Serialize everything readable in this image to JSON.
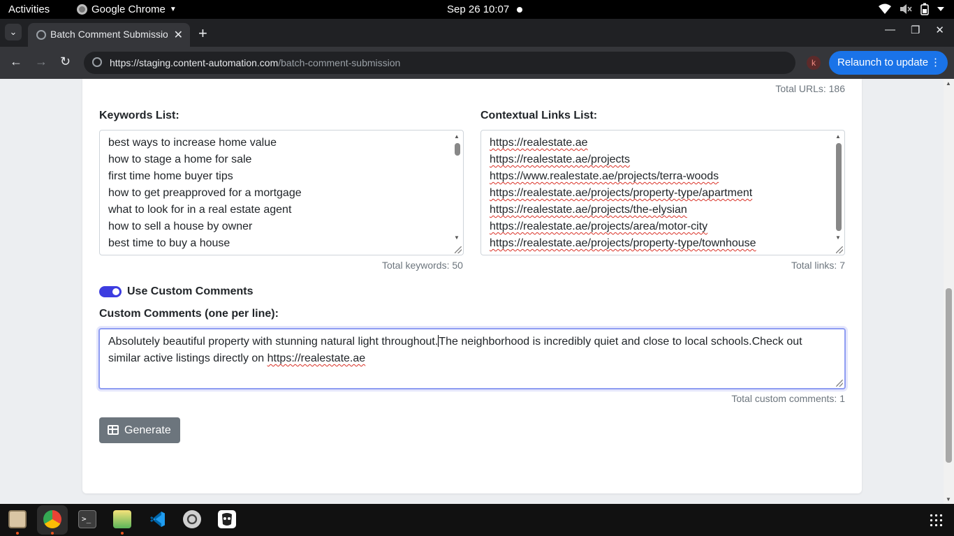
{
  "system_bar": {
    "activities": "Activities",
    "app_name": "Google Chrome",
    "datetime": "Sep 26  10:07"
  },
  "browser": {
    "tab_title": "Batch Comment Submission",
    "url_host": "https://staging.content-automation.com",
    "url_path": "/batch-comment-submission",
    "profile_initial": "k",
    "relaunch_label": "Relaunch to update"
  },
  "page": {
    "total_urls": "Total URLs: 186",
    "keywords": {
      "label": "Keywords List:",
      "items": [
        "best ways to increase home value",
        "how to stage a home for sale",
        "first time home buyer tips",
        "how to get preapproved for a mortgage",
        "what to look for in a real estate agent",
        "how to sell a house by owner",
        "best time to buy a house"
      ],
      "total": "Total keywords: 50"
    },
    "links": {
      "label": "Contextual Links List:",
      "items": [
        "https://realestate.ae",
        "https://realestate.ae/projects",
        "https://www.realestate.ae/projects/terra-woods",
        "https://realestate.ae/projects/property-type/apartment",
        "https://realestate.ae/projects/the-elysian",
        "https://realestate.ae/projects/area/motor-city",
        "https://realestate.ae/projects/property-type/townhouse"
      ],
      "total": "Total links: 7"
    },
    "toggle_label": "Use Custom Comments",
    "toggle_on": true,
    "custom_comments": {
      "label": "Custom Comments (one per line):",
      "text_before_caret": "Absolutely beautiful property with stunning natural light throughout.",
      "text_after_caret": "The neighborhood is incredibly quiet and close to local schools.Check out similar active listings directly on ",
      "link_text": "https://realestate.ae",
      "total": "Total custom comments: 1"
    },
    "generate_label": "Generate"
  },
  "colors": {
    "accent": "#3d3de0",
    "button": "#6c757d",
    "relaunch": "#1a73e8"
  }
}
